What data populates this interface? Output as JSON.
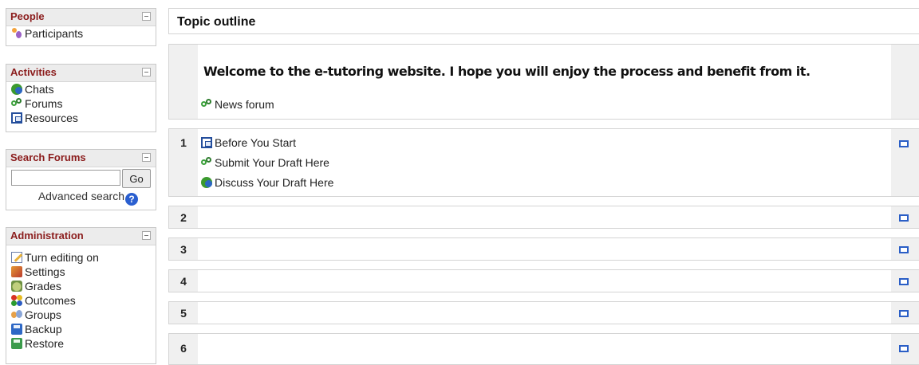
{
  "sidebar": {
    "people": {
      "title": "People",
      "items": [
        {
          "label": "Participants",
          "icon": "participants-icon"
        }
      ]
    },
    "activities": {
      "title": "Activities",
      "items": [
        {
          "label": "Chats",
          "icon": "chat-icon"
        },
        {
          "label": "Forums",
          "icon": "forum-icon"
        },
        {
          "label": "Resources",
          "icon": "resource-icon"
        }
      ]
    },
    "search_forums": {
      "title": "Search Forums",
      "input_value": "",
      "go_label": "Go",
      "advanced_label": "Advanced search",
      "help_glyph": "?"
    },
    "administration": {
      "title": "Administration",
      "items": [
        {
          "label": "Turn editing on",
          "icon": "edit-icon"
        },
        {
          "label": "Settings",
          "icon": "settings-icon"
        },
        {
          "label": "Grades",
          "icon": "grades-icon"
        },
        {
          "label": "Outcomes",
          "icon": "outcomes-icon"
        },
        {
          "label": "Groups",
          "icon": "groups-icon"
        },
        {
          "label": "Backup",
          "icon": "backup-icon"
        },
        {
          "label": "Restore",
          "icon": "restore-icon"
        }
      ]
    }
  },
  "main": {
    "title": "Topic outline",
    "welcome": "Welcome to the e-tutoring website. I hope you will enjoy the process and benefit from it.",
    "news_forum": "News forum",
    "sections": [
      {
        "number": "1",
        "activities": [
          {
            "label": "Before You Start",
            "icon": "resource-icon"
          },
          {
            "label": "Submit Your Draft Here",
            "icon": "forum-icon"
          },
          {
            "label": "Discuss Your Draft Here",
            "icon": "chat-icon"
          }
        ]
      },
      {
        "number": "2"
      },
      {
        "number": "3"
      },
      {
        "number": "4"
      },
      {
        "number": "5"
      },
      {
        "number": "6"
      }
    ]
  },
  "colors": {
    "block_title": "#8b1c1c",
    "link_icon_blue": "#2a5ec6",
    "section_bg": "#f0f0f0"
  }
}
